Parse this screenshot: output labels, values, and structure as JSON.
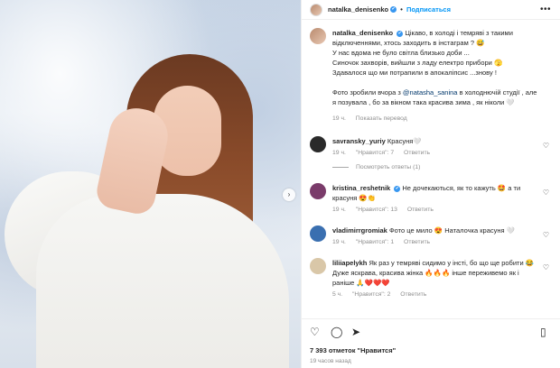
{
  "post": {
    "username": "natalka_denisenko",
    "verified_mark": "✔",
    "separator": "•",
    "follow_label": "Подписаться",
    "more_label": "•••",
    "next_arrow": "›"
  },
  "caption": {
    "username": "natalka_denisenko",
    "line1": "Цікаво, в холоді і темряві з такими відключеннями, хтось заходить в інстаграм ? 😅",
    "line2": "У нас вдома не було світла близько доби ...",
    "line3": "Синочок захворів, вийшли з ладу електро прибори 🫣",
    "line4": "Здавалося що ми потрапили в апокаліпсис ...знову !",
    "line5_pre": "Фото зробили вчора з ",
    "line5_mention": "@natasha_sanina",
    "line5_post": " в холоднючій студії , але я позувала , бо за вікном така красива зима , як ніколи 🤍",
    "time": "19 ч.",
    "translate": "Показать перевод"
  },
  "comments": [
    {
      "username": "savransky_yuriy",
      "text": "Красуня🤍",
      "time": "19 ч.",
      "likes": "\"Нравится\": 7",
      "reply": "Ответить",
      "avatar_color": "#2a2a2a",
      "view_replies": "Посмотреть ответы (1)"
    },
    {
      "username": "kristina_reshetnik",
      "verified": true,
      "text": "Не дочекаються, як то кажуть 🤩 а ти красуня 😍👏",
      "time": "19 ч.",
      "likes": "\"Нравится\": 13",
      "reply": "Ответить",
      "avatar_color": "#7a3b6a"
    },
    {
      "username": "vladimirrgromiak",
      "text": "Фото це мило 😍 Наталочка красуня 🤍",
      "time": "19 ч.",
      "likes": "\"Нравится\": 1",
      "reply": "Ответить",
      "avatar_color": "#3a6fb0"
    },
    {
      "username": "liliiapelykh",
      "text": "Як раз у темряві сидимо у інсті, бо що ще робити 😂 Дуже яскрава, красива жінка 🔥🔥🔥 інше переживемо як і раніше 🙏❤️❤️❤️",
      "time": "5 ч.",
      "likes": "\"Нравится\": 2",
      "reply": "Ответить",
      "avatar_color": "#d9c7a8"
    }
  ],
  "actions": {
    "like_icon": "♡",
    "comment_icon": "◯",
    "share_icon": "➤",
    "save_icon": "▯",
    "likes_count": "7 393 отметок \"Нравится\"",
    "posted_ago": "19 часов назад"
  },
  "colors": {
    "link": "#0095f6",
    "muted": "#8e8e8e",
    "verified": "#3897f0"
  }
}
